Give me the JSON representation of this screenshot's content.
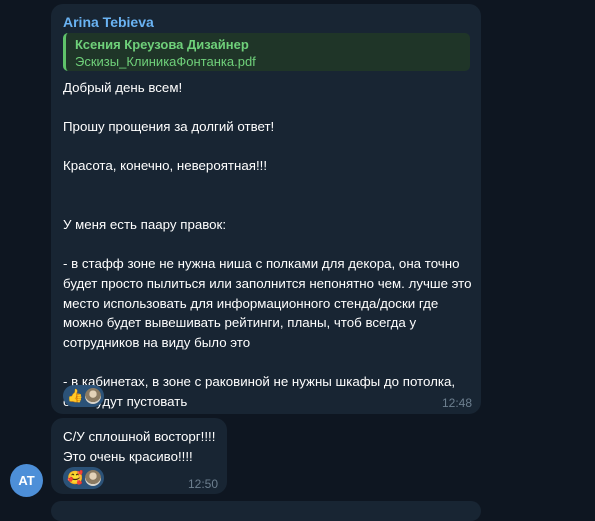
{
  "colors": {
    "background": "#0e1621",
    "bubble": "#182533",
    "sender_name": "#6ab3f3",
    "reply_accent": "#5fc26a",
    "reaction_pill": "#2b5278",
    "avatar": "#4d8fd8"
  },
  "messages": [
    {
      "sender": "Arina Tebieva",
      "reply": {
        "name": "Ксения Креузова Дизайнер",
        "file": "Эскизы_КлиникаФонтанка.pdf"
      },
      "text": "Добрый день всем!\n\nПрошу прощения за долгий ответ!\n\nКрасота, конечно, невероятная!!!\n\n\nУ меня есть паару правок:\n\n- в стафф зоне не нужна ниша с полками для декора, она точно будет просто пылиться или заполнится непонятно чем. лучшe это место использовать для информационного стенда/доски где можно будет вывешивать рейтинги, планы, чтоб всегда у сотрудников на виду было это\n\n- в кабинетах, в зоне с раковиной не нужны шкафы до потолка, они будут пустовать",
      "reaction": {
        "emoji": "👍",
        "icon": "reactor-avatar-icon"
      },
      "time": "12:48"
    },
    {
      "text": "С/У сплошной восторг!!!!\nЭто очень красиво!!!!",
      "reaction": {
        "emoji": "🥰",
        "icon": "reactor-avatar-icon"
      },
      "time": "12:50"
    }
  ],
  "avatar_initials": "AT"
}
